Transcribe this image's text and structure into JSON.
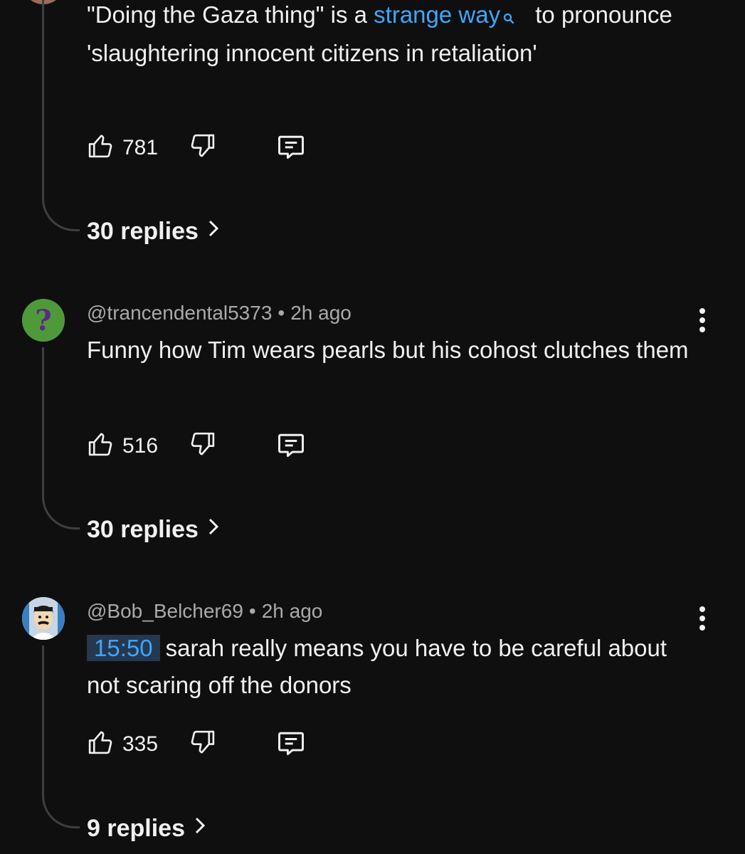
{
  "comments": [
    {
      "text_before_link": "\"Doing the Gaza thing\" is a ",
      "link_text": "strange way",
      "text_after_link": " to pronounce 'slaughtering innocent citizens in retaliation'",
      "likes": "781",
      "replies_label": "30 replies",
      "icons": {
        "like": "thumbs-up-icon",
        "dislike": "thumbs-down-icon",
        "reply": "reply-comment-icon",
        "link": "search-icon"
      }
    },
    {
      "author": "@trancendental5373",
      "separator": "•",
      "time": "2h ago",
      "text": "Funny how Tim wears pearls but his cohost clutches them",
      "likes": "516",
      "replies_label": "30 replies",
      "avatar": "question-mark-avatar"
    },
    {
      "author": "@Bob_Belcher69",
      "separator": "•",
      "time": "2h ago",
      "timestamp": "15:50",
      "text": "sarah really means you have to be careful about not scaring off the donors",
      "likes": "335",
      "replies_label": "9 replies",
      "avatar": "cartoon-man-avatar"
    }
  ],
  "colors": {
    "background": "#0f0f0f",
    "text": "#f1f1f1",
    "secondary_text": "#aaaaaa",
    "link": "#3ea6ff",
    "timestamp_bg": "#263850"
  }
}
